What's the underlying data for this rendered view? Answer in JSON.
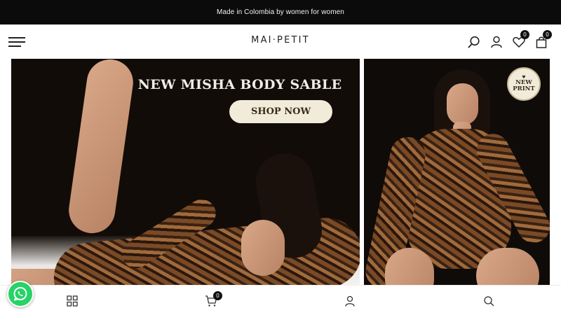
{
  "announcement": {
    "text": "Made in Colombia by women for women"
  },
  "header": {
    "logo": "MAI·PETIT",
    "menu_icon": "hamburger-menu-icon",
    "search_icon": "search-icon",
    "account_icon": "user-icon",
    "wishlist_icon": "heart-icon",
    "wishlist_count": "0",
    "cart_icon": "shopping-bag-icon",
    "cart_count": "0"
  },
  "hero_left": {
    "headline": "NEW MISHA BODY SABLE",
    "cta_label": "SHOP NOW"
  },
  "hero_right": {
    "badge_heart": "♥",
    "badge_line1": "NEW",
    "badge_line2": "PRINT"
  },
  "bottom_nav": {
    "whatsapp_icon": "whatsapp-icon",
    "shop_icon": "grid-icon",
    "cart_icon": "cart-icon",
    "cart_count": "0",
    "account_icon": "user-icon",
    "search_icon": "search-icon"
  },
  "colors": {
    "announcement_bg": "#0b0b0b",
    "button_bg": "#f1ecd9",
    "whatsapp_green": "#25d366"
  }
}
